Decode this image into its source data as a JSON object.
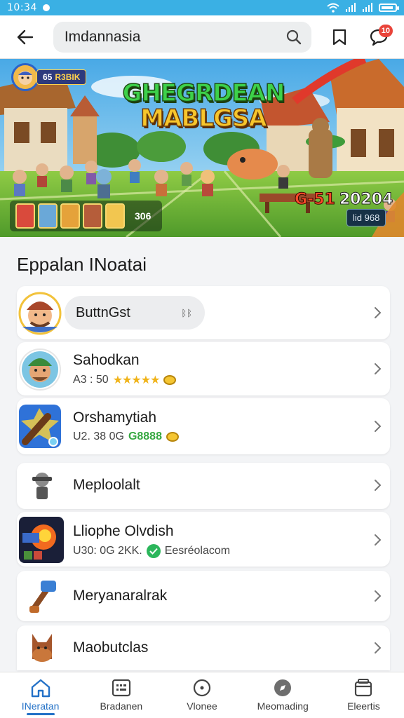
{
  "status_bar": {
    "time": "10:34"
  },
  "header": {
    "search_value": "Imdannasia",
    "notification_count": "10",
    "icons": {
      "back": "back-arrow-icon",
      "search": "search-icon",
      "bookmark": "bookmark-icon",
      "chat": "chat-icon"
    }
  },
  "banner": {
    "title_line1": "GHEGRDEAN",
    "title_line2": "MABLGSA",
    "player_level": "65",
    "player_name": "R3BIK",
    "hero_count": "306",
    "score": "G-51",
    "year": "20204",
    "event_label": "lid 968"
  },
  "section": {
    "title": "Eppalan INoatai"
  },
  "list": [
    {
      "name": "ButtnGst",
      "sub": "ᛒᛒ",
      "type": "pill"
    },
    {
      "name": "Sahodkan",
      "meta": "A3 : 50",
      "stars": "★★★★★"
    },
    {
      "name": "Orshamytiah",
      "meta": "U2. 38 0G",
      "rating_text": "G8888"
    },
    {
      "name": "Meploolalt"
    },
    {
      "name": "Lliophe Olvdish",
      "meta": "U30: 0G 2KK.",
      "extra": "Eesréolacom"
    },
    {
      "name": "Meryanaralrak"
    },
    {
      "name": "Maobutclas"
    }
  ],
  "bottom_nav": [
    {
      "label": "INeratan",
      "icon": "home-icon",
      "active": true
    },
    {
      "label": "Bradanen",
      "icon": "grid-icon",
      "active": false
    },
    {
      "label": "Vlonee",
      "icon": "circle-icon",
      "active": false
    },
    {
      "label": "Meomading",
      "icon": "compass-icon",
      "active": false
    },
    {
      "label": "Eleertis",
      "icon": "inbox-icon",
      "active": false
    }
  ],
  "colors": {
    "status_bar": "#3ab0e4",
    "accent": "#2371c7",
    "badge": "#e9443a"
  }
}
